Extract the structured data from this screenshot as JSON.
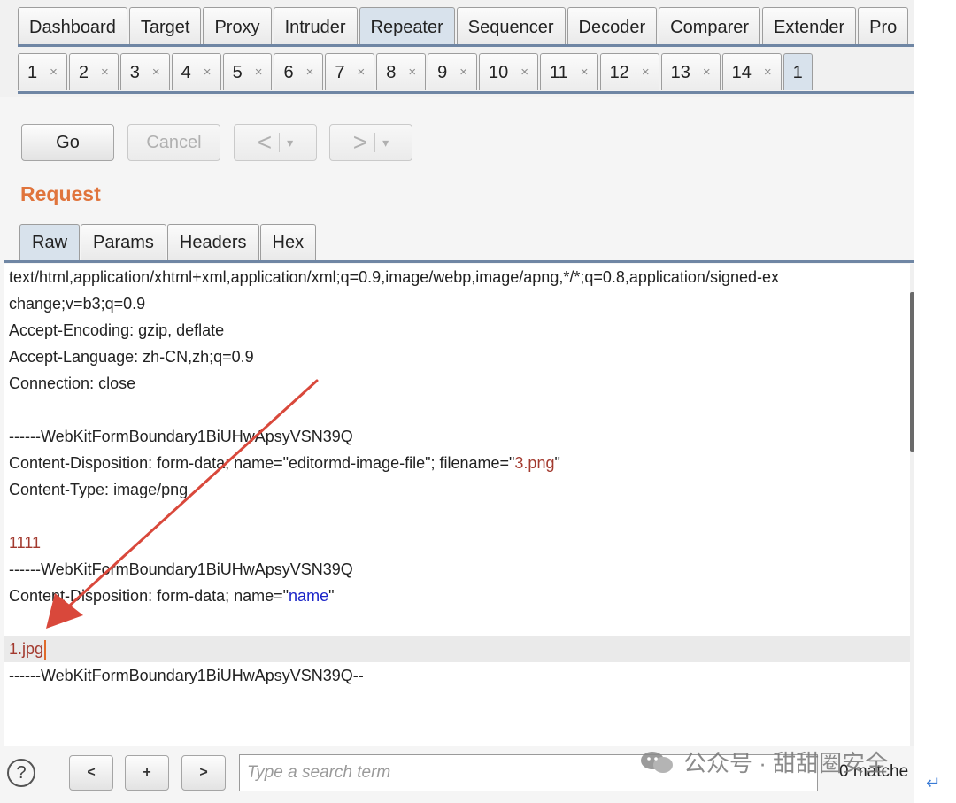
{
  "main_tabs": [
    "Dashboard",
    "Target",
    "Proxy",
    "Intruder",
    "Repeater",
    "Sequencer",
    "Decoder",
    "Comparer",
    "Extender",
    "Pro"
  ],
  "active_main_tab": "Repeater",
  "repeater_tabs": [
    "1",
    "2",
    "3",
    "4",
    "5",
    "6",
    "7",
    "8",
    "9",
    "10",
    "11",
    "12",
    "13",
    "14",
    "1"
  ],
  "tab_close_glyph": "×",
  "toolbar": {
    "go": "Go",
    "cancel": "Cancel",
    "back": "<",
    "forward": ">",
    "dropdown": "▾"
  },
  "request_title": "Request",
  "request_tabs": [
    "Raw",
    "Params",
    "Headers",
    "Hex"
  ],
  "editor_lines": {
    "l1": "text/html,application/xhtml+xml,application/xml;q=0.9,image/webp,image/apng,*/*;q=0.8,application/signed-ex",
    "l2": "change;v=b3;q=0.9",
    "l3": "Accept-Encoding: gzip, deflate",
    "l4": "Accept-Language: zh-CN,zh;q=0.9",
    "l5": "Connection: close",
    "l7": "------WebKitFormBoundary1BiUHwApsyVSN39Q",
    "l8_prefix": "Content-Disposition: form-data; name=\"editormd-image-file\"; filename=\"",
    "l8_value": "3.png",
    "l8_suffix": "\"",
    "l9": "Content-Type: image/png",
    "l11": "1111",
    "l12": "------WebKitFormBoundary1BiUHwApsyVSN39Q",
    "l13_prefix": "Content-Disposition: form-data; name=\"",
    "l13_value": "name",
    "l13_suffix": "\"",
    "l15": "1.jpg",
    "l16": "------WebKitFormBoundary1BiUHwApsyVSN39Q--"
  },
  "bottom": {
    "help": "?",
    "prev": "<",
    "add": "+",
    "next": ">",
    "search_placeholder": "Type a search term",
    "matches": "0 matche"
  },
  "watermark": "公众号 · 甜甜圈安全",
  "return_glyph": "↵",
  "colors": {
    "accent_orange": "#e0743c",
    "active_tab": "#d8e2ec",
    "arrow_red": "#d9483b"
  }
}
